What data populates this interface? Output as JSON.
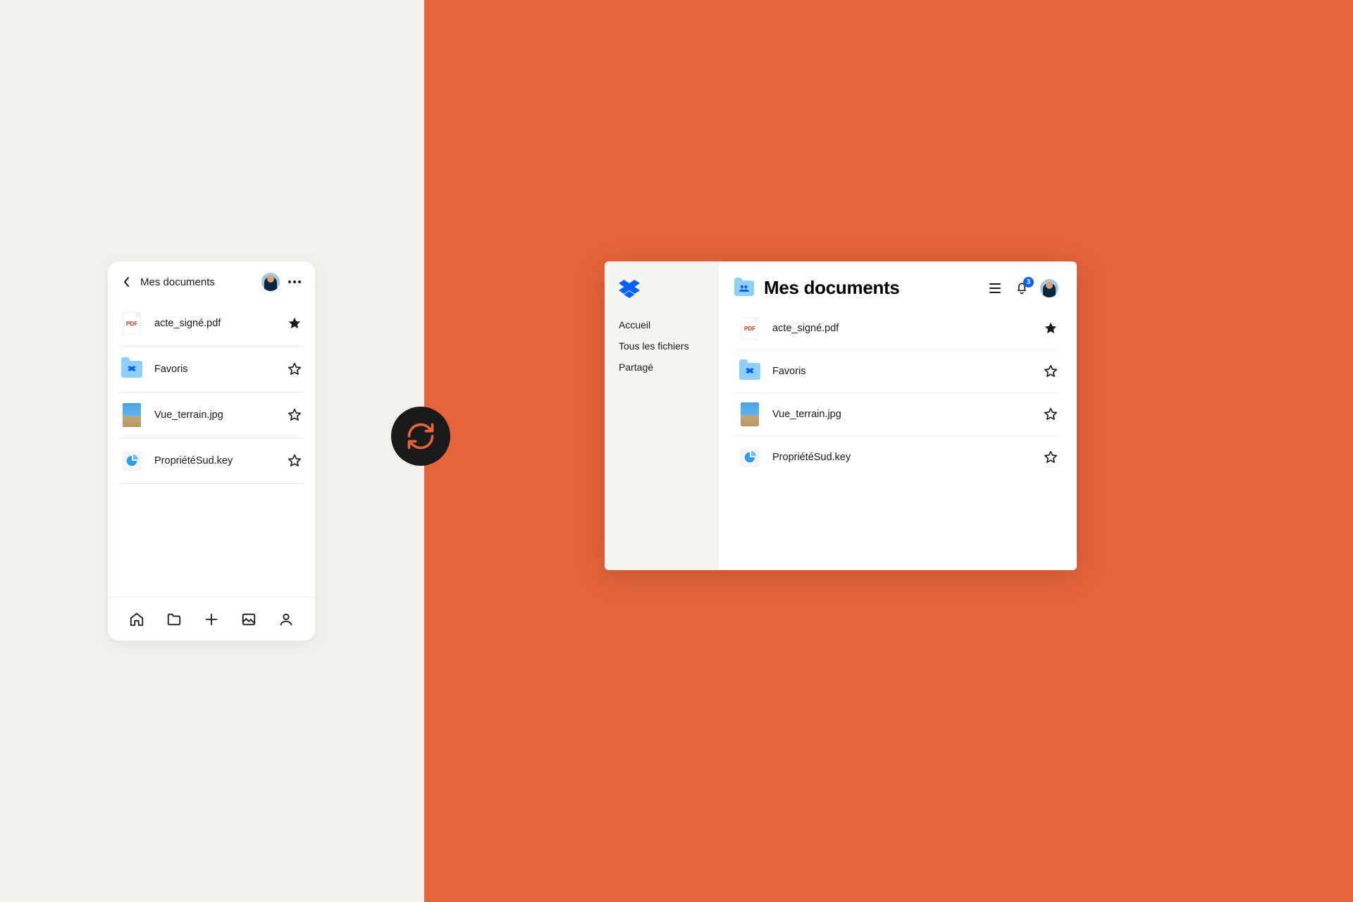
{
  "mobile": {
    "title": "Mes documents",
    "files": [
      {
        "name": "acte_signé.pdf",
        "type": "pdf",
        "starred": true
      },
      {
        "name": "Favoris",
        "type": "folder",
        "starred": false
      },
      {
        "name": "Vue_terrain.jpg",
        "type": "image",
        "starred": false
      },
      {
        "name": "PropriétéSud.key",
        "type": "keynote",
        "starred": false
      }
    ]
  },
  "desktop": {
    "title": "Mes documents",
    "notification_count": "3",
    "sidebar": {
      "items": [
        {
          "label": "Accueil"
        },
        {
          "label": "Tous les fichiers"
        },
        {
          "label": "Partagé"
        }
      ]
    },
    "files": [
      {
        "name": "acte_signé.pdf",
        "type": "pdf",
        "starred": true
      },
      {
        "name": "Favoris",
        "type": "folder",
        "starred": false
      },
      {
        "name": "Vue_terrain.jpg",
        "type": "image",
        "starred": false
      },
      {
        "name": "PropriétéSud.key",
        "type": "keynote",
        "starred": false
      }
    ]
  },
  "icons": {
    "pdf_label": "PDF"
  },
  "colors": {
    "accent_orange": "#e5643a",
    "dropbox_blue": "#0061fe",
    "folder_blue": "#8fd0fb"
  }
}
